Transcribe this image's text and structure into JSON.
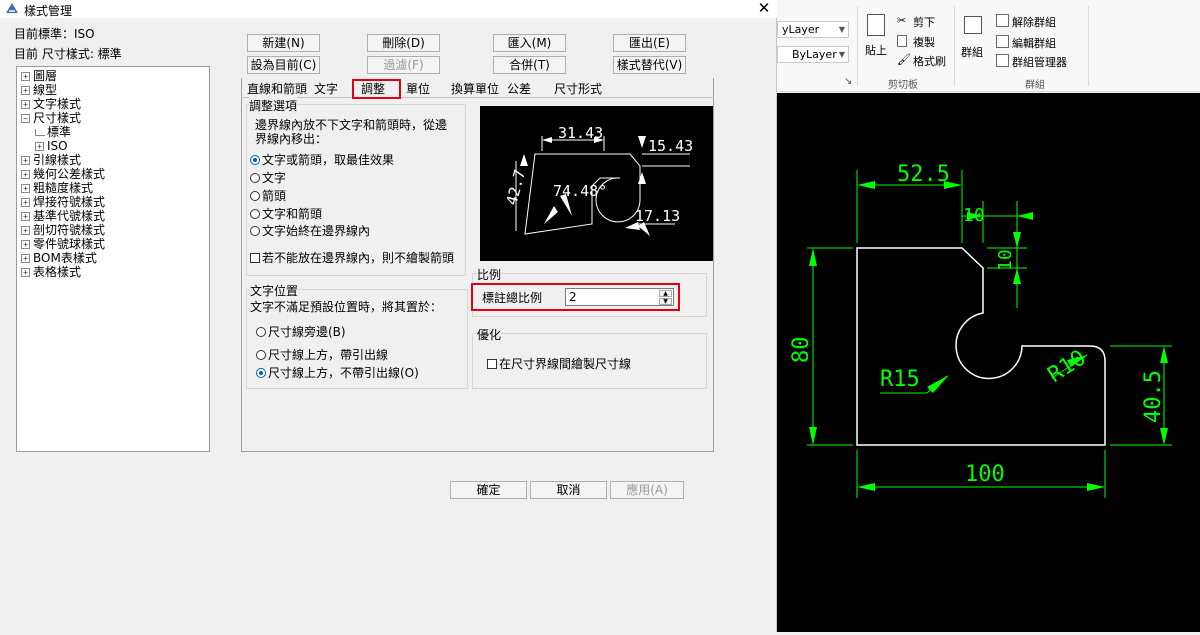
{
  "dialog": {
    "title": "樣式管理",
    "close_glyph": "✕",
    "current_standard": "目前標準：ISO",
    "current_dim_style": "目前 尺寸樣式: 標準"
  },
  "tree": {
    "items": [
      "圖層",
      "線型",
      "文字樣式",
      "尺寸樣式",
      "標準",
      "ISO",
      "引線樣式",
      "幾何公差樣式",
      "粗糙度樣式",
      "焊接符號樣式",
      "基準代號樣式",
      "剖切符號樣式",
      "零件號球樣式",
      "BOM表樣式",
      "表格樣式"
    ]
  },
  "buttons": {
    "new": "新建(N)",
    "delete": "刪除(D)",
    "import": "匯入(M)",
    "export": "匯出(E)",
    "set_current": "設為目前(C)",
    "filter": "過濾(F)",
    "merge": "合併(T)",
    "override": "樣式替代(V)",
    "ok": "確定",
    "cancel": "取消",
    "apply": "應用(A)"
  },
  "tabs": [
    "直線和箭頭",
    "文字",
    "調整",
    "單位",
    "換算單位",
    "公差",
    "尺寸形式"
  ],
  "active_tab": "調整",
  "fit_options": {
    "title": "調整選項",
    "desc_line1": "邊界線內放不下文字和箭頭時，從邊",
    "desc_line2": "界線內移出：",
    "radios": [
      "文字或箭頭，取最佳效果",
      "文字",
      "箭頭",
      "文字和箭頭",
      "文字始終在邊界線內"
    ],
    "selected": 0,
    "checkbox": "若不能放在邊界線內，則不繪製箭頭"
  },
  "text_placement": {
    "title": "文字位置",
    "desc": "文字不滿足預設位置時，將其置於：",
    "radios": [
      "尺寸線旁邊(B)",
      "尺寸線上方，帶引出線",
      "尺寸線上方，不帶引出線(O)"
    ],
    "selected": 2
  },
  "scale": {
    "title": "比例",
    "label": "標註總比例",
    "value": "2"
  },
  "optimize": {
    "title": "優化",
    "checkbox": "在尺寸界線間繪製尺寸線"
  },
  "preview": {
    "dims": [
      "31.43",
      "15.43",
      "42.7",
      "74.48°",
      "17.13"
    ]
  },
  "ribbon": {
    "layer_combo": "yLayer",
    "bylayer_combo": "ByLayer",
    "paste": "貼上",
    "cut": "剪下",
    "copy": "複製",
    "format_painter": "格式刷",
    "clipboard_group": "剪切板",
    "group_btn": "群組",
    "ungroup": "解除群組",
    "edit_group": "編輯群組",
    "group_manager": "群組管理器",
    "group_group": "群組"
  },
  "cad": {
    "dims": [
      "52.5",
      "10",
      "10",
      "80",
      "R15",
      "R10",
      "40.5",
      "100"
    ]
  },
  "colors": {
    "accent_red": "#e0000f",
    "radio_blue": "#005fb8",
    "cad_green": "#00ff00",
    "cad_bg": "#000000"
  }
}
